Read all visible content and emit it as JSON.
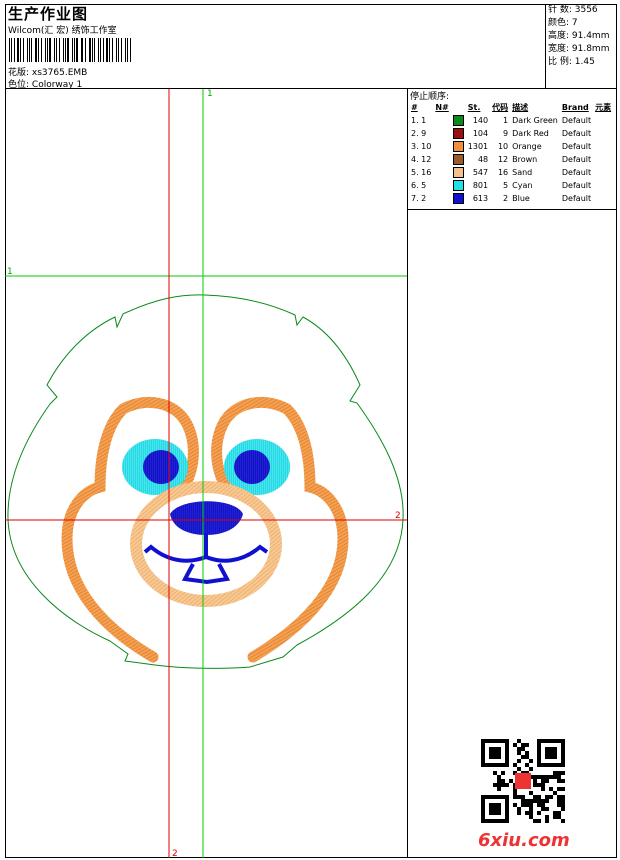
{
  "header": {
    "title": "生产作业图",
    "company": "Wilcom(汇 宏) 绣饰工作室",
    "design_label": "花版:",
    "design_value": "xs3765.EMB",
    "colorway_label": "色位:",
    "colorway_value": "Colorway 1"
  },
  "specs": {
    "stitches": "针 数: 3556",
    "colors": "颜色: 7",
    "height": "高度: 91.4mm",
    "width": "宽度: 91.8mm",
    "scale": "比 例: 1.45"
  },
  "axes": {
    "v1": "1",
    "h1": "1",
    "v2": "2",
    "h2": "2"
  },
  "stop_sequence": {
    "heading": "停止顺序:",
    "columns": [
      "#",
      "N#",
      "St.",
      "代码",
      "描述",
      "Brand",
      "元素"
    ],
    "rows": [
      {
        "idx": "1. 1",
        "color": "#0a8a1a",
        "st": "140",
        "code": "1",
        "desc": "Dark Green",
        "brand": "Default"
      },
      {
        "idx": "2. 9",
        "color": "#9a1010",
        "st": "104",
        "code": "9",
        "desc": "Dark Red",
        "brand": "Default"
      },
      {
        "idx": "3. 10",
        "color": "#f0903a",
        "st": "1301",
        "code": "10",
        "desc": "Orange",
        "brand": "Default"
      },
      {
        "idx": "4. 12",
        "color": "#9a5a2a",
        "st": "48",
        "code": "12",
        "desc": "Brown",
        "brand": "Default"
      },
      {
        "idx": "5. 16",
        "color": "#f5c08a",
        "st": "547",
        "code": "16",
        "desc": "Sand",
        "brand": "Default"
      },
      {
        "idx": "6. 5",
        "color": "#20e0e8",
        "st": "801",
        "code": "5",
        "desc": "Cyan",
        "brand": "Default"
      },
      {
        "idx": "7. 2",
        "color": "#1010d0",
        "st": "613",
        "code": "2",
        "desc": "Blue",
        "brand": "Default"
      }
    ]
  },
  "watermark": "6xiu.com"
}
